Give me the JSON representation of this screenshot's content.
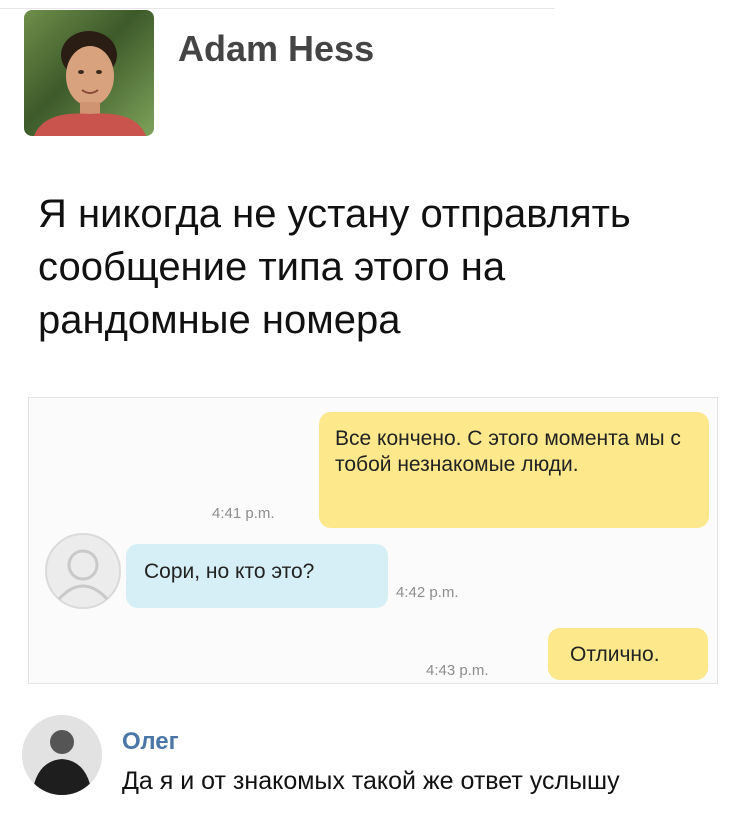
{
  "post": {
    "author": "Adam Hess",
    "text": "Я никогда не устану отправлять сообщение типа этого на рандомные номера"
  },
  "chat": {
    "messages": [
      {
        "side": "outgoing",
        "text": "Все кончено. С этого момента мы с тобой незнакомые люди.",
        "time": "4:41 p.m."
      },
      {
        "side": "incoming",
        "text": "Сори, но кто это?",
        "time": "4:42 p.m."
      },
      {
        "side": "outgoing",
        "text": "Отлично.",
        "time": "4:43 p.m."
      }
    ]
  },
  "comment": {
    "author": "Олег",
    "text": "Да я и от знакомых такой же ответ услышу"
  },
  "colors": {
    "outgoing_bubble": "#fde88c",
    "incoming_bubble": "#d6eef5",
    "comment_author": "#4a76a8"
  },
  "icons": {
    "adam_avatar": "profile-photo",
    "contact_avatar": "default-contact-icon",
    "oleg_avatar": "profile-photo"
  }
}
